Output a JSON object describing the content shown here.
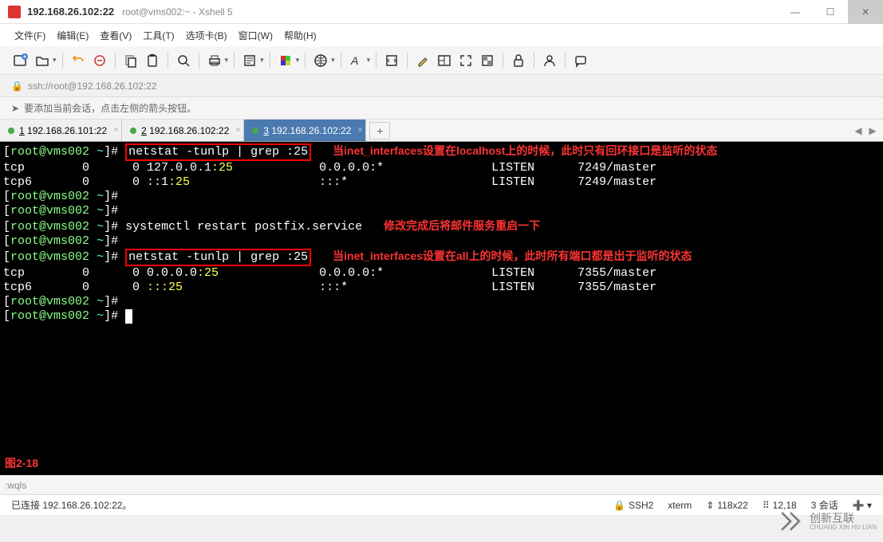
{
  "title": {
    "main": "192.168.26.102:22",
    "sub": "root@vms002:~ - Xshell 5"
  },
  "menu": [
    "文件(F)",
    "编辑(E)",
    "查看(V)",
    "工具(T)",
    "选项卡(B)",
    "窗口(W)",
    "帮助(H)"
  ],
  "address": "ssh://root@192.168.26.102:22",
  "hint": "要添加当前会话，点击左侧的箭头按钮。",
  "tabs": [
    {
      "num": "1",
      "label": "192.168.26.101:22",
      "active": false
    },
    {
      "num": "2",
      "label": "192.168.26.102:22",
      "active": false
    },
    {
      "num": "3",
      "label": "192.168.26.102:22",
      "active": true
    }
  ],
  "term": {
    "prompt_user": "root@vms002",
    "prompt_path": "~",
    "cmd1": "netstat -tunlp | grep :25",
    "note1": "当inet_interfaces设置在localhost上的时候，此时只有回环接口是监听的状态",
    "l1a": "tcp        0      0 127.0.0.1",
    "l1b": ":25",
    "l1c": "            0.0.0.0:*               LISTEN      7249/master",
    "l2a": "tcp6       0      0 ::1",
    "l2b": ":25",
    "l2c": "                  :::*                    LISTEN      7249/master",
    "cmd2": "systemctl restart postfix.service",
    "note2": "修改完成后将邮件服务重启一下",
    "cmd3": "netstat -tunlp | grep :25",
    "note3": "当inet_interfaces设置在all上的时候，此时所有端口都是出于监听的状态",
    "l3a": "tcp        0      0 0.0.0.0",
    "l3b": ":25",
    "l3c": "              0.0.0.0:*               LISTEN      7355/master",
    "l4a": "tcp6       0      0 ",
    "l4b": ":::25",
    "l4c": "                   :::*                    LISTEN      7355/master",
    "figure": "图2-18"
  },
  "cmdbar": ":wqls",
  "status": {
    "left": "已连接 192.168.26.102:22。",
    "proto": "SSH2",
    "term": "xterm",
    "size": "118x22",
    "pos": "12,18",
    "sess": "3 会话"
  },
  "watermark": {
    "name": "创新互联",
    "sub": "CHUANG XIN HU LIAN"
  }
}
